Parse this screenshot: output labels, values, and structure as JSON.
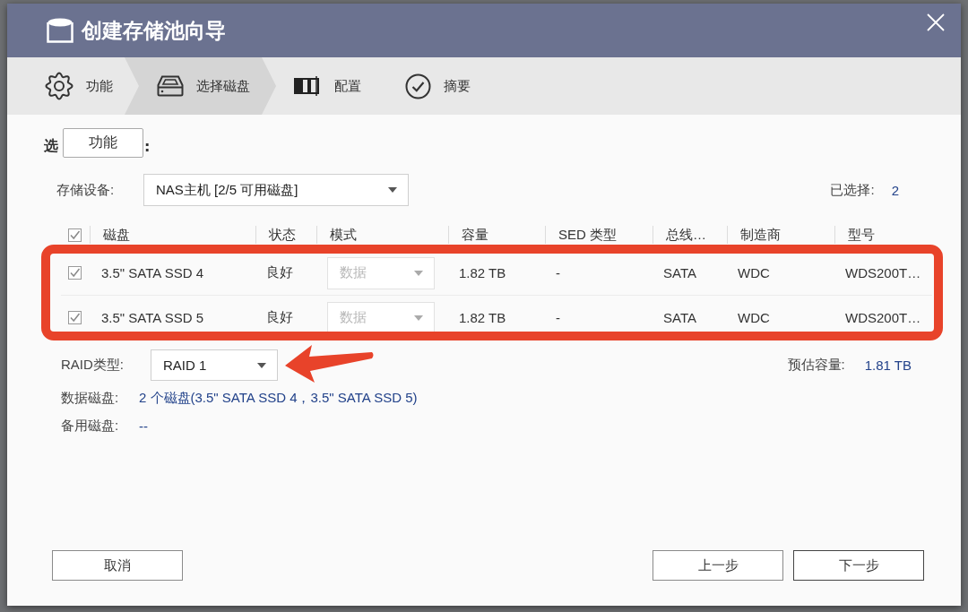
{
  "window": {
    "title": "创建存储池向导"
  },
  "steps": [
    {
      "label": "功能",
      "selected": false
    },
    {
      "label": "选择磁盘",
      "selected": true
    },
    {
      "label": "配置",
      "selected": false
    },
    {
      "label": "摘要",
      "selected": false
    }
  ],
  "section_label": {
    "start": "选",
    "end": ":"
  },
  "tooltip": {
    "text": "功能"
  },
  "storage_device": {
    "label": "存储设备:",
    "value": "NAS主机 [2/5 可用磁盘]"
  },
  "selected_count": {
    "label": "已选择:",
    "value": "2"
  },
  "table": {
    "select_all": {
      "checked": true
    },
    "columns": [
      "磁盘",
      "状态",
      "模式",
      "容量",
      "SED 类型",
      "总线…",
      "制造商",
      "型号"
    ],
    "rows": [
      {
        "checked": true,
        "disk": "3.5\" SATA SSD 4",
        "status": "良好",
        "mode": {
          "value": "数据",
          "disabled": true
        },
        "capacity": "1.82 TB",
        "sed_type": "-",
        "bus": "SATA",
        "manufacturer": "WDC",
        "model": "WDS200T…"
      },
      {
        "checked": true,
        "disk": "3.5\" SATA SSD 5",
        "status": "良好",
        "mode": {
          "value": "数据",
          "disabled": true
        },
        "capacity": "1.82 TB",
        "sed_type": "-",
        "bus": "SATA",
        "manufacturer": "WDC",
        "model": "WDS200T…"
      }
    ]
  },
  "raid_type": {
    "label": "RAID类型:",
    "value": "RAID 1"
  },
  "estimated_capacity": {
    "label": "预估容量:",
    "value": "1.81 TB"
  },
  "data_disks": {
    "label": "数据磁盘:",
    "value": "2 个磁盘(3.5\" SATA SSD 4，3.5\" SATA SSD 5)"
  },
  "spare_disks": {
    "label": "备用磁盘:",
    "value": "--"
  },
  "buttons": [
    {
      "label": "取消",
      "focused": false
    },
    {
      "label": "上一步",
      "focused": false
    },
    {
      "label": "下一步",
      "focused": true
    }
  ]
}
